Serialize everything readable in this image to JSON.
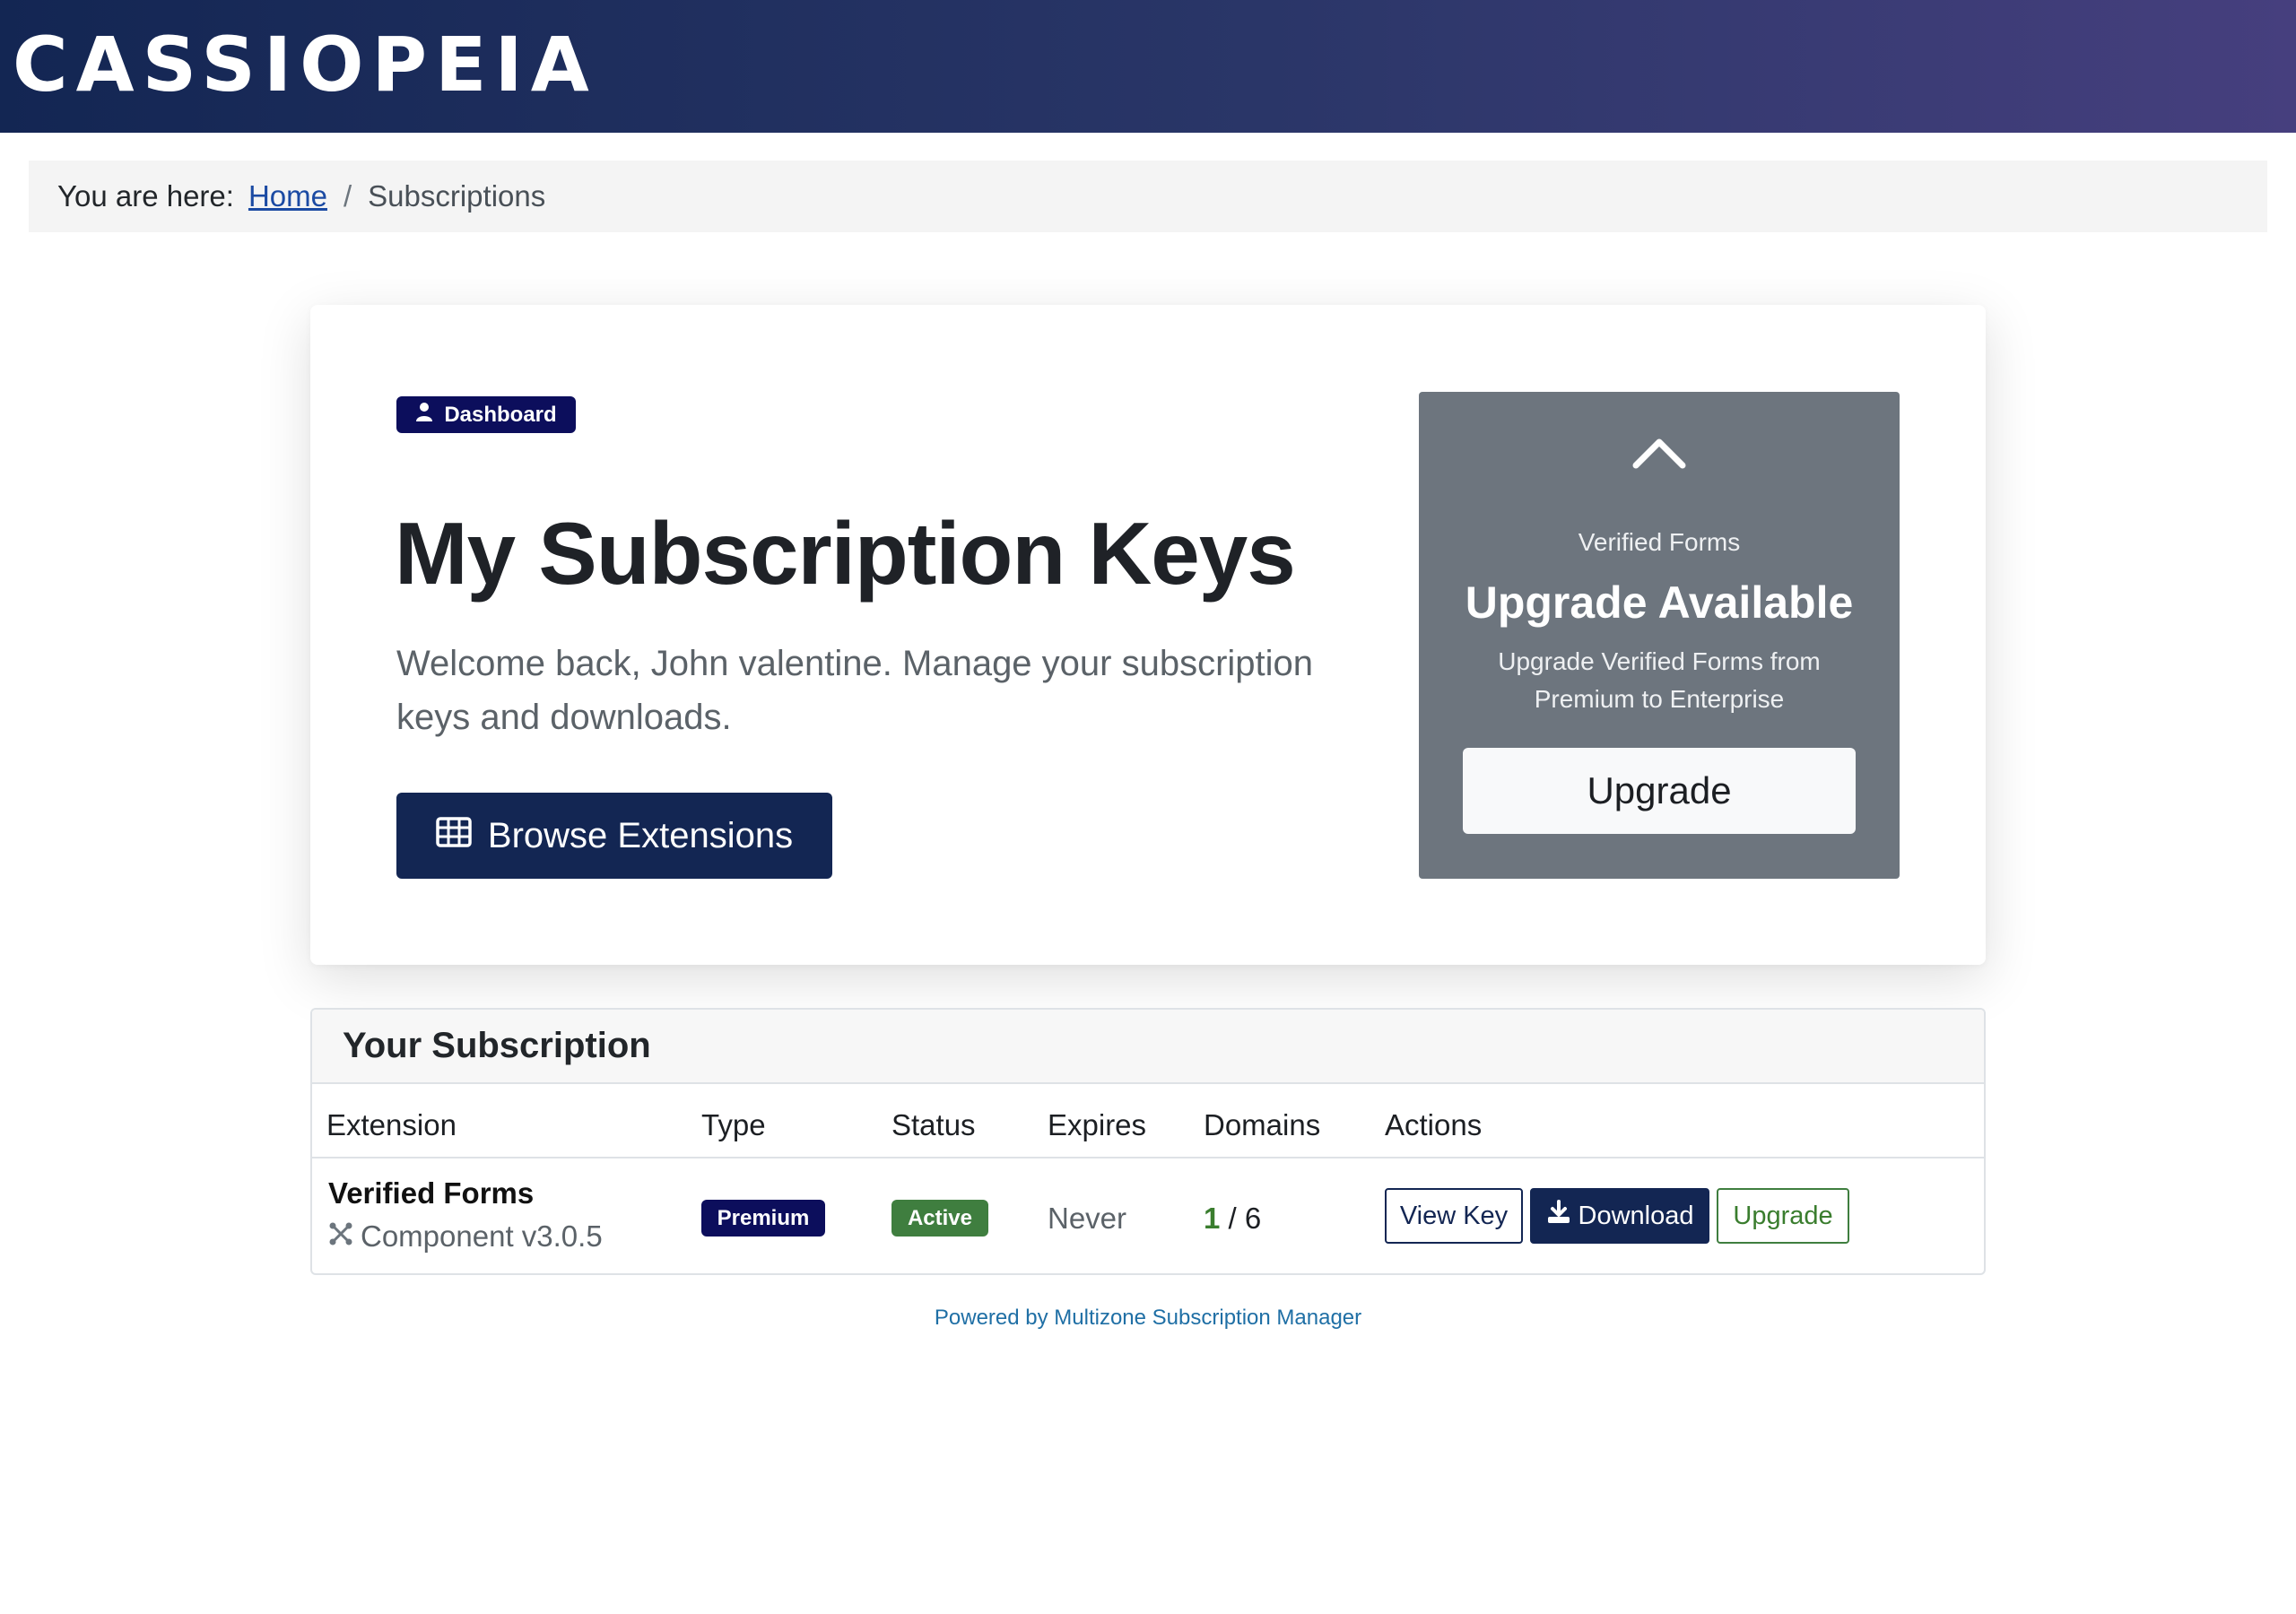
{
  "header": {
    "brand": "CASSIOPEIA"
  },
  "breadcrumb": {
    "prefix": "You are here:",
    "home": "Home",
    "separator": "/",
    "current": "Subscriptions"
  },
  "hero": {
    "badge": "Dashboard",
    "badge_icon": "user-icon",
    "title": "My Subscription Keys",
    "subtitle": "Welcome back, John valentine. Manage your subscription keys and downloads.",
    "browse_button": "Browse Extensions",
    "browse_icon": "grid-icon"
  },
  "upgrade_panel": {
    "icon": "chevron-up-icon",
    "extension": "Verified Forms",
    "title": "Upgrade Available",
    "description": "Upgrade Verified Forms from Premium to Enterprise",
    "button": "Upgrade"
  },
  "subscription": {
    "heading": "Your Subscription",
    "columns": [
      "Extension",
      "Type",
      "Status",
      "Expires",
      "Domains",
      "Actions"
    ],
    "row": {
      "extension_name": "Verified Forms",
      "extension_detail": "Component v3.0.5",
      "extension_icon": "joomla-icon",
      "type": "Premium",
      "status": "Active",
      "expires": "Never",
      "domains_used": "1",
      "domains_separator": "/",
      "domains_total": "6",
      "actions": {
        "view_key": "View Key",
        "download": "Download",
        "upgrade": "Upgrade"
      }
    }
  },
  "footer": {
    "powered_by": "Powered by Multizone Subscription Manager"
  },
  "colors": {
    "header_start": "#132653",
    "header_end": "#463f7e",
    "primary": "#132653",
    "badge": "#0c0e5c",
    "success": "#3f7e3f",
    "panel": "#6d757e",
    "link": "#1b4aa3"
  }
}
